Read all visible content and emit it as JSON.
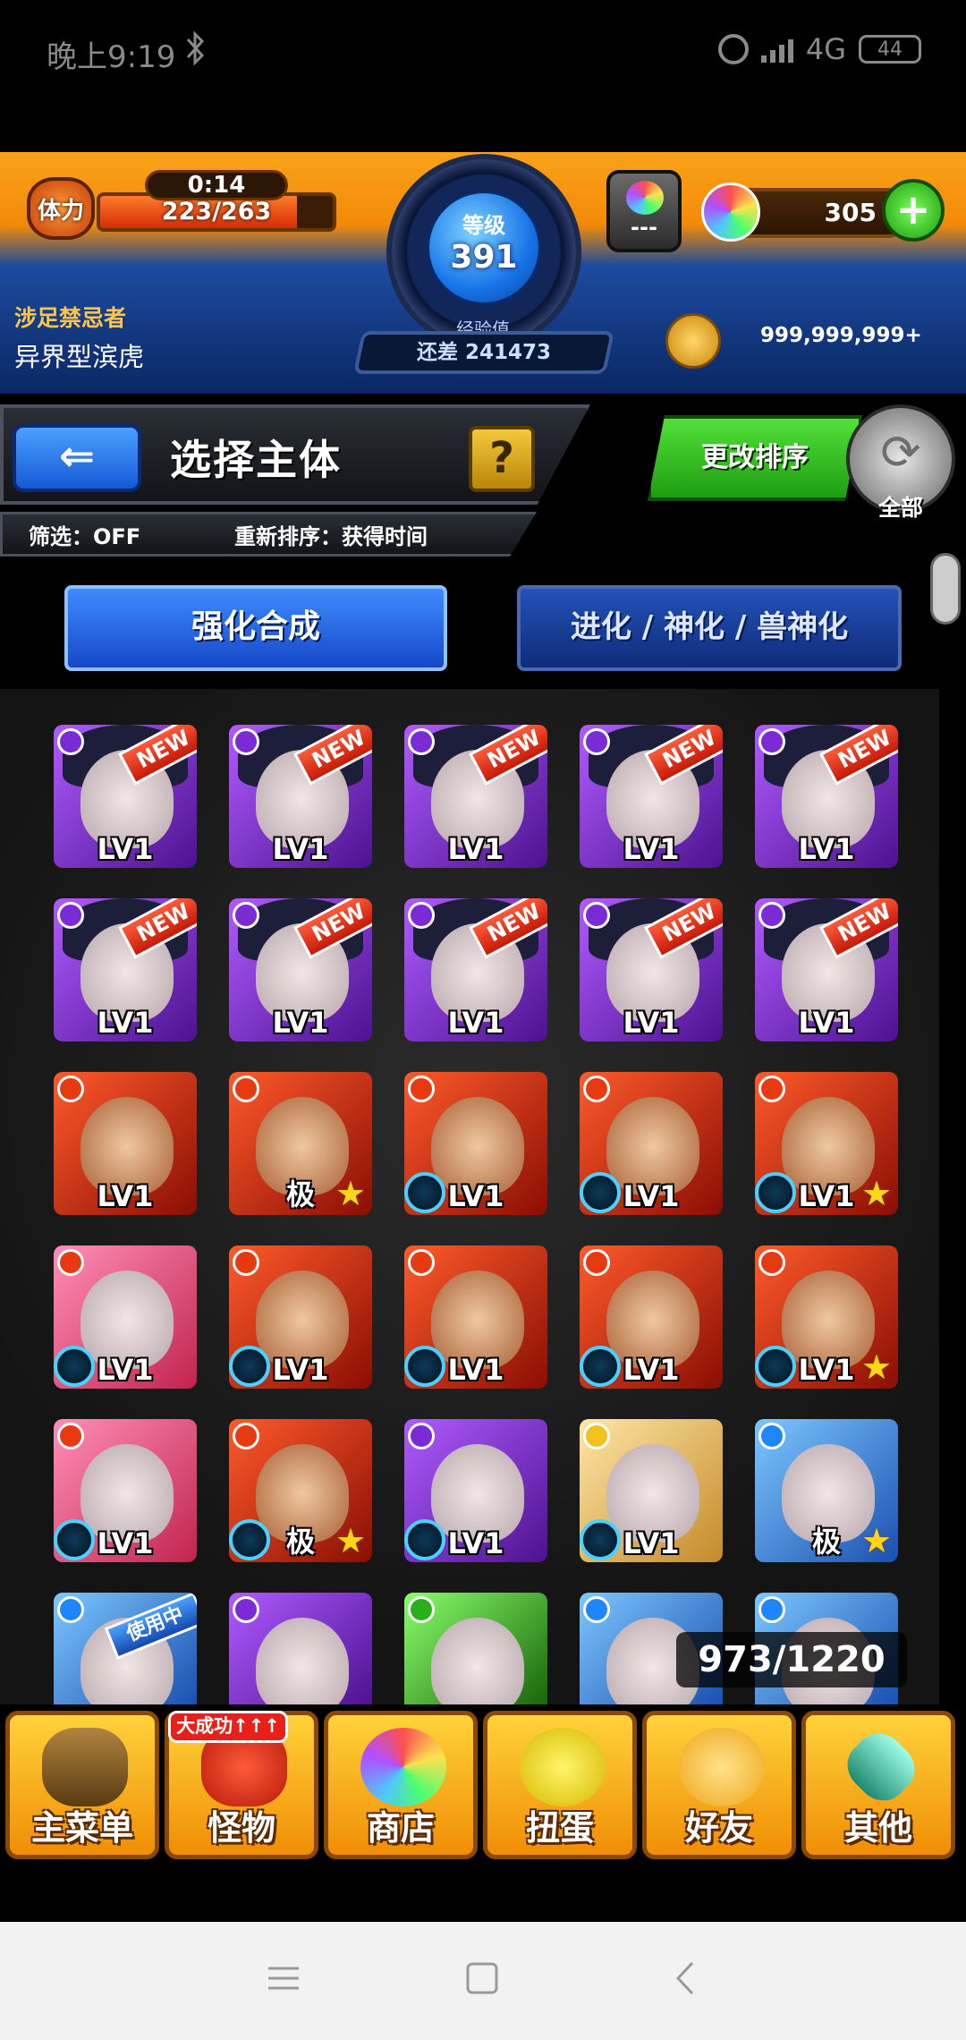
{
  "status_bar": {
    "time": "晚上9:19",
    "network": "4G",
    "battery": "44"
  },
  "hud": {
    "stamina_label": "体力",
    "stamina_timer": "0:14",
    "stamina_value": "223/263",
    "stamina_fraction": 0.848,
    "level_label": "等级",
    "level": "391",
    "exp_label": "经验值",
    "exp_remaining": "还差 241473",
    "pot_label": "---",
    "orbs": "305",
    "plus": "+",
    "player_title": "涉足禁忌者",
    "player_name": "异界型滨虎",
    "gold": "999,999,999+"
  },
  "section": {
    "back": "⇐",
    "title": "选择主体",
    "help": "?",
    "filter": "筛选：OFF",
    "sort": "重新排序：获得时间",
    "sort_button": "更改排序",
    "all_button": "全部"
  },
  "tabs": {
    "tab1": "强化合成",
    "tab2": "进化 / 神化 / 兽神化"
  },
  "monsters": {
    "lv": "LV1",
    "max": "极",
    "new": "NEW",
    "in_use": "使用中",
    "star": "★"
  },
  "box_count": "973/1220",
  "menu": {
    "promo": "大成功↑↑↑",
    "items": [
      {
        "label": "主菜单"
      },
      {
        "label": "怪物"
      },
      {
        "label": "商店"
      },
      {
        "label": "扭蛋"
      },
      {
        "label": "好友"
      },
      {
        "label": "其他"
      }
    ]
  }
}
